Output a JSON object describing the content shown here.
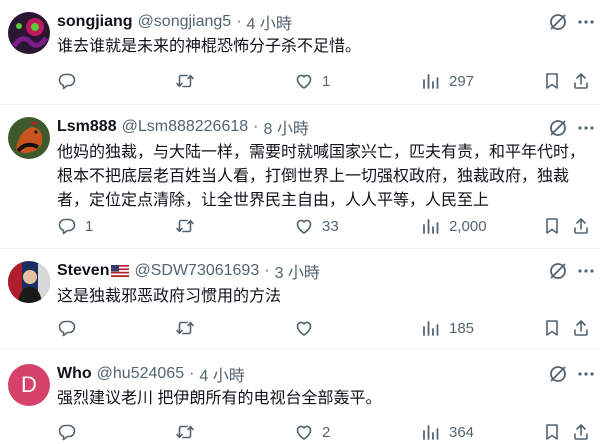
{
  "tweets": [
    {
      "name": "songjiang",
      "handle": "@songjiang5",
      "sep": "·",
      "time": "4 小時",
      "text": "谁去谁就是未来的神棍恐怖分子杀不足惜。",
      "replies": "",
      "retweets": "",
      "likes": "1",
      "views": "297",
      "avatar_colors": [
        "#2a1533",
        "#c0185c",
        "#5cc733"
      ]
    },
    {
      "name": "Lsm888",
      "handle": "@Lsm888226618",
      "sep": "·",
      "time": "8 小時",
      "text": "他妈的独裁，与大陆一样，需要时就喊国家兴亡，匹夫有责，和平年代时，根本不把底层老百姓当人看，打倒世界上一切强权政府，独裁政府，独裁者，定位定点清除，让全世界民主自由，人人平等，人民至上",
      "replies": "1",
      "retweets": "",
      "likes": "33",
      "views": "2,000",
      "avatar_colors": [
        "#3f5a2a",
        "#c9541f",
        "#111111"
      ]
    },
    {
      "name": "Steven",
      "handle": "@SDW73061693",
      "sep": "·",
      "time": "3 小時",
      "text": "这是独裁邪恶政府习惯用的方法",
      "replies": "",
      "retweets": "",
      "likes": "",
      "views": "185",
      "avatar_colors": [
        "#1b2d63",
        "#d8d8d8",
        "#b01d2e"
      ]
    },
    {
      "name": "Who",
      "handle": "@hu524065",
      "sep": "·",
      "time": "4 小時",
      "text": "强烈建议老川 把伊朗所有的电视台全部轰平。",
      "replies": "",
      "retweets": "",
      "likes": "2",
      "views": "364",
      "avatar_letter": "D",
      "avatar_colors": [
        "#d6416a"
      ]
    }
  ],
  "colors": {
    "text": "#0f1419",
    "secondary": "#536471",
    "divider": "#eff3f4"
  },
  "icons": [
    "grok-icon",
    "more-icon",
    "reply-icon",
    "retweet-icon",
    "like-icon",
    "views-icon",
    "bookmark-icon",
    "share-icon",
    "us-flag-icon"
  ]
}
